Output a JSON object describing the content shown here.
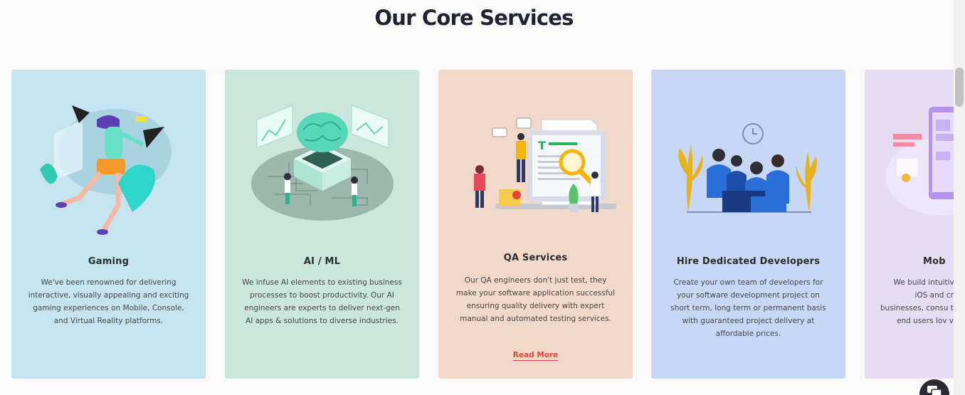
{
  "section": {
    "title": "Our Core Services"
  },
  "colors": {
    "gaming_bg": "#c5e4ef",
    "ai_bg": "#cbe6db",
    "qa_bg": "#f2d8c9",
    "hire_bg": "#c6d8f5",
    "mobile_bg": "#e6dcf4",
    "link": "#e3453a"
  },
  "cards": [
    {
      "title": "Gaming",
      "description": "We've been renowned for delivering interactive, visually appealing and exciting gaming experiences on Mobile, Console, and Virtual Reality platforms.",
      "icon": "vr-gamer-illustration"
    },
    {
      "title": "AI / ML",
      "description": "We infuse AI elements to existing business processes to boost productivity. Our AI engineers are experts to deliver next-gen AI apps & solutions to diverse industries.",
      "icon": "brain-chip-illustration"
    },
    {
      "title": "QA Services",
      "description": "Our QA engineers don't just test, they make your software application successful ensuring quality delivery with expert manual and automated testing services.",
      "link": "Read More",
      "icon": "qa-magnifier-illustration"
    },
    {
      "title": "Hire Dedicated Developers",
      "description": "Create your own team of developers for your software development project on short term, long term or permanent basis with guaranteed project delivery at affordable prices.",
      "icon": "developer-team-illustration"
    },
    {
      "title": "Mob",
      "description": "We build intuitive a iOS and cross businesses, consu that end users lov very",
      "icon": "mobile-app-illustration"
    }
  ]
}
